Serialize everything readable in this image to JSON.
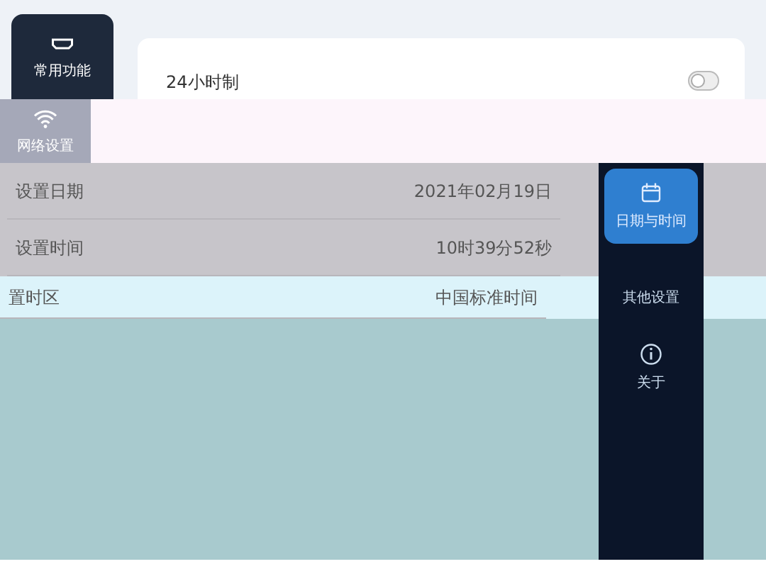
{
  "top_nav": [
    {
      "label": "常用功能",
      "selected": true
    },
    {
      "label": "网络设置",
      "selected": false
    }
  ],
  "clock_format": {
    "label": "24小时制",
    "on": false
  },
  "settings": [
    {
      "label": "设置日期",
      "value": "2021年02月19日"
    },
    {
      "label": "设置时间",
      "value": "10时39分52秒"
    },
    {
      "label": "置时区",
      "value": "中国标准时间"
    }
  ],
  "side_nav": [
    {
      "label": "日期与时间",
      "selected": true
    },
    {
      "label": "其他设置",
      "selected": false
    },
    {
      "label": "关于",
      "selected": false
    }
  ]
}
